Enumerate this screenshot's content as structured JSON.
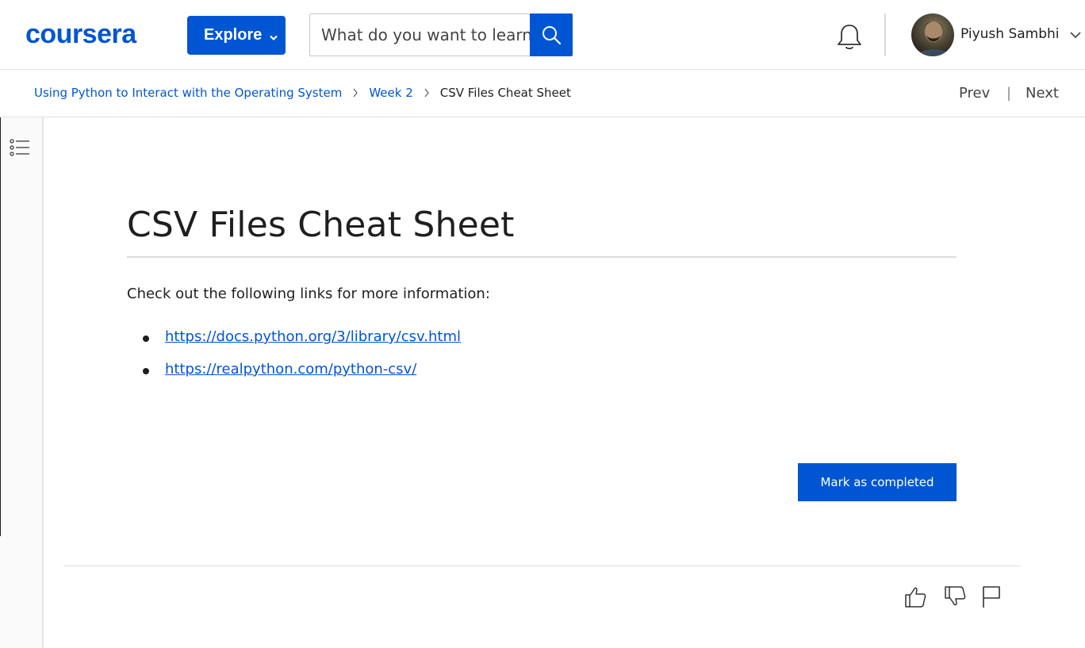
{
  "brand": {
    "name": "coursera",
    "color": "#0056d2"
  },
  "header": {
    "explore_label": "Explore",
    "search_placeholder": "What do you want to learn?",
    "search_value": "",
    "user_name": "Piyush Sambhi",
    "icons": {
      "search": "search-icon",
      "bell": "bell-icon",
      "chevron": "chevron-down-icon"
    }
  },
  "breadcrumb": {
    "course": "Using Python to Interact with the Operating System",
    "week": "Week 2",
    "current": "CSV Files Cheat Sheet"
  },
  "nav": {
    "prev": "Prev",
    "next": "Next",
    "separator": "|"
  },
  "content": {
    "title": "CSV Files Cheat Sheet",
    "intro": "Check out the following links for more information:",
    "links": [
      "https://docs.python.org/3/library/csv.html",
      "https://realpython.com/python-csv/"
    ],
    "mark_button": "Mark as completed"
  },
  "feedback": {
    "icons": [
      "thumbs-up-icon",
      "thumbs-down-icon",
      "flag-icon"
    ]
  }
}
